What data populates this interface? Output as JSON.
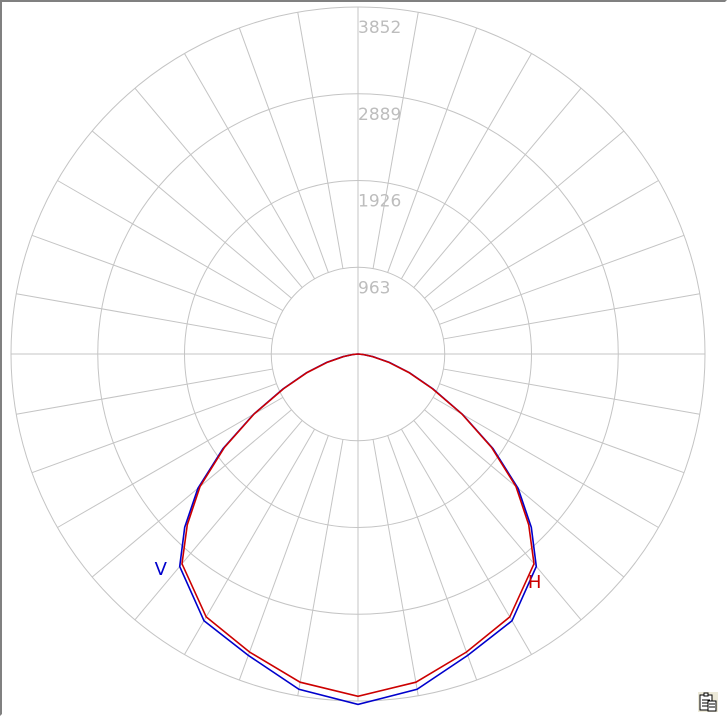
{
  "chart_data": {
    "type": "polar",
    "radial_max": 3852,
    "ring_labels": [
      "963",
      "1926",
      "2889",
      "3852"
    ],
    "angle_step_deg": 10,
    "series": [
      {
        "name": "V",
        "color": "#0000cc",
        "angles_deg": [
          0,
          10,
          20,
          30,
          40,
          45,
          50,
          55,
          60,
          65,
          70,
          75,
          80,
          85,
          90
        ],
        "values": [
          3890,
          3780,
          3560,
          3420,
          3080,
          2720,
          2320,
          1830,
          1340,
          920,
          610,
          360,
          170,
          50,
          0
        ]
      },
      {
        "name": "H",
        "color": "#cc0000",
        "angles_deg": [
          0,
          10,
          20,
          30,
          40,
          45,
          50,
          55,
          60,
          65,
          70,
          75,
          80,
          85,
          90
        ],
        "values": [
          3800,
          3700,
          3520,
          3370,
          3040,
          2680,
          2290,
          1810,
          1330,
          910,
          600,
          350,
          160,
          50,
          0
        ]
      }
    ]
  },
  "toolbar": {
    "copy_icon": "clipboard-icon"
  }
}
